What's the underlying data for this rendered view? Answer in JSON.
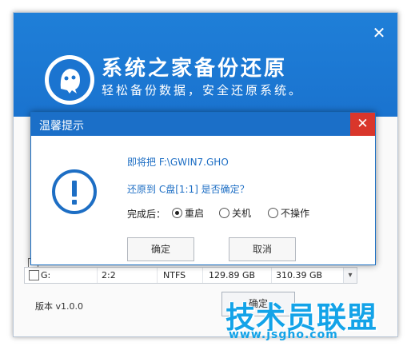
{
  "app": {
    "title": "系统之家备份还原",
    "slogan": "轻松备份数据，安全还原系统。",
    "close_glyph": "✕",
    "version": "版本 v1.0.0",
    "confirm_button": "确定",
    "header_color": "#1b74d0"
  },
  "partition_row": {
    "drive": "G:",
    "index": "2:2",
    "fs": "NTFS",
    "free": "129.89 GB",
    "total": "310.39 GB",
    "scroll_glyph": "▾"
  },
  "dialog": {
    "title": "温馨提示",
    "close_glyph": "✕",
    "line1": "即将把 F:\\GWIN7.GHO",
    "line2": "还原到 C盘[1:1] 是否确定？",
    "after_label": "完成后：",
    "options": [
      {
        "label": "重启",
        "selected": true
      },
      {
        "label": "关机",
        "selected": false
      },
      {
        "label": "不操作",
        "selected": false
      }
    ],
    "ok_label": "确定",
    "cancel_label": "取消",
    "accent": "#1b6fc8",
    "close_color": "#d9362b"
  },
  "watermark": {
    "text": "技术员联盟",
    "url": "www.jsgho.com"
  },
  "icons": [
    "ghost-logo-icon",
    "close-icon",
    "exclamation-icon",
    "radio-icon",
    "chevron-down-icon"
  ]
}
